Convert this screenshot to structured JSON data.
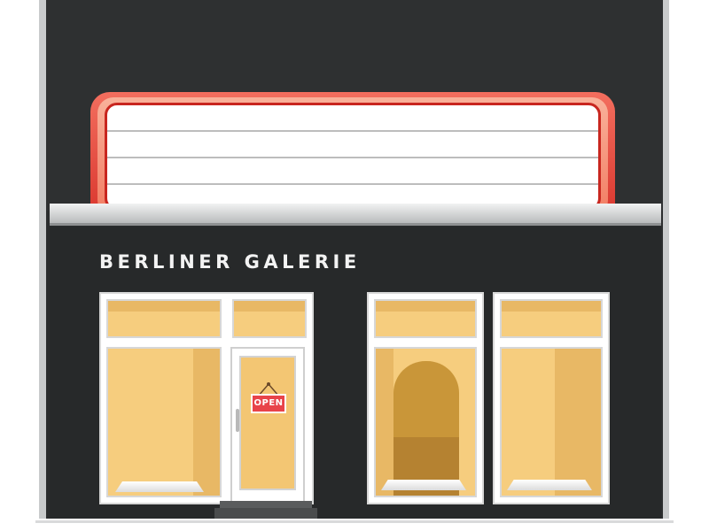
{
  "shop": {
    "name": "BERLINER GALERIE",
    "door_sign": "OPEN"
  },
  "colors": {
    "facade": "#2b2d2e",
    "marquee_red": "#d8342c",
    "window_light": "#f6cd7e",
    "sign_red": "#e8434a"
  }
}
